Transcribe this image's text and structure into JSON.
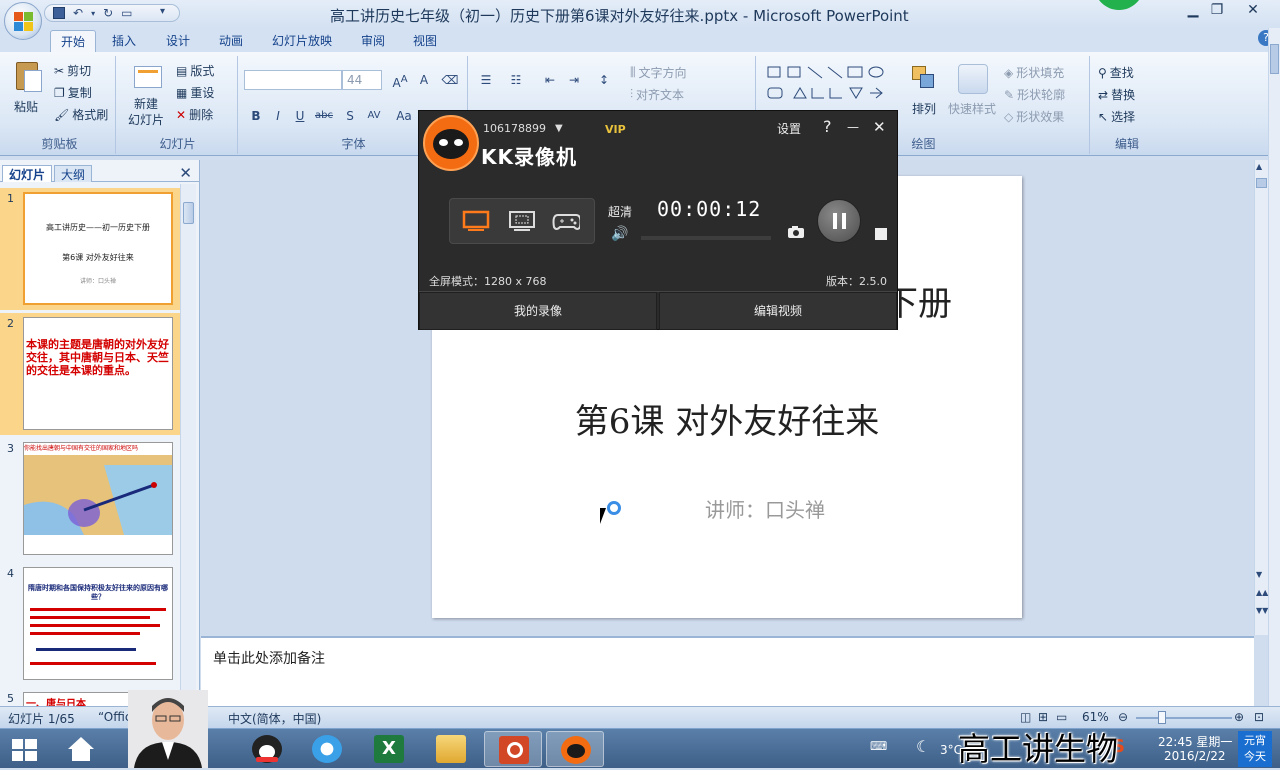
{
  "window": {
    "title": "高工讲历史七年级（初一）历史下册第6课对外友好往来.pptx - Microsoft PowerPoint",
    "minimize": "▁",
    "restore": "❐",
    "close": "✕"
  },
  "ribbon_tabs": [
    "开始",
    "插入",
    "设计",
    "动画",
    "幻灯片放映",
    "审阅",
    "视图"
  ],
  "ribbon": {
    "clipboard": {
      "label": "剪贴板",
      "paste": "粘贴",
      "cut": "剪切",
      "copy": "复制",
      "format_painter": "格式刷"
    },
    "slides": {
      "label": "幻灯片",
      "new_slide": "新建\n幻灯片",
      "layout": "版式",
      "reset": "重设",
      "delete": "删除"
    },
    "font": {
      "label": "字体",
      "font_size": "44"
    },
    "paragraph": {
      "text_direction": "文字方向",
      "align_text": "对齐文本"
    },
    "drawing": {
      "label": "绘图",
      "arrange": "排列",
      "quick_styles": "快速样式",
      "shape_fill": "形状填充",
      "shape_outline": "形状轮廓",
      "shape_effects": "形状效果"
    },
    "editing": {
      "label": "编辑",
      "find": "查找",
      "replace": "替换",
      "select": "选择"
    }
  },
  "left_pane": {
    "tab_slides": "幻灯片",
    "tab_outline": "大纲",
    "close": "✕",
    "thumbnails": [
      {
        "num": "1",
        "line1": "高工讲历史——初一历史下册",
        "line2": "第6课 对外友好往来",
        "line3": "讲师：口头禅"
      },
      {
        "num": "2",
        "text": "本课的主题是唐朝的对外友好交往，其中唐朝与日本、天竺的交往是本课的重点。"
      },
      {
        "num": "3",
        "heading": "你能找出唐朝与中国有交往的国家和地区吗"
      },
      {
        "num": "4",
        "heading": "隋唐时期和各国保持积极友好往来的原因有哪些？"
      },
      {
        "num": "5",
        "heading": "一、唐与日本"
      }
    ]
  },
  "slide": {
    "title_partial": "下册",
    "subtitle": "第6课 对外友好往来",
    "lecturer": "讲师：口头禅"
  },
  "notes": {
    "placeholder": "单击此处添加备注"
  },
  "status_bar": {
    "slide_info": "幻灯片 1/65",
    "theme": "“Offic",
    "language": "中文(简体，中国)",
    "zoom": "61%"
  },
  "kk_recorder": {
    "user_id": "106178899",
    "vip": "VIP",
    "app_name": "KK录像机",
    "settings": "设置",
    "help": "?",
    "minimize": "—",
    "close": "✕",
    "quality": "超清",
    "elapsed": "00:00:12",
    "mode_info": "全屏模式：1280 x 768",
    "version": "版本：2.5.0",
    "my_recordings": "我的录像",
    "edit_video": "编辑视频"
  },
  "taskbar": {
    "time": "22:45 星期一",
    "date": "2016/2/22",
    "temperature": "3°C",
    "corner_line1": "元宵",
    "corner_line2": "今天"
  },
  "watermark": "高工讲生物",
  "colors": {
    "ribbon_bg": "#dbe7f5",
    "kk_orange": "#f36c12",
    "selection": "#fbd68a",
    "slide_red": "#d40000"
  }
}
